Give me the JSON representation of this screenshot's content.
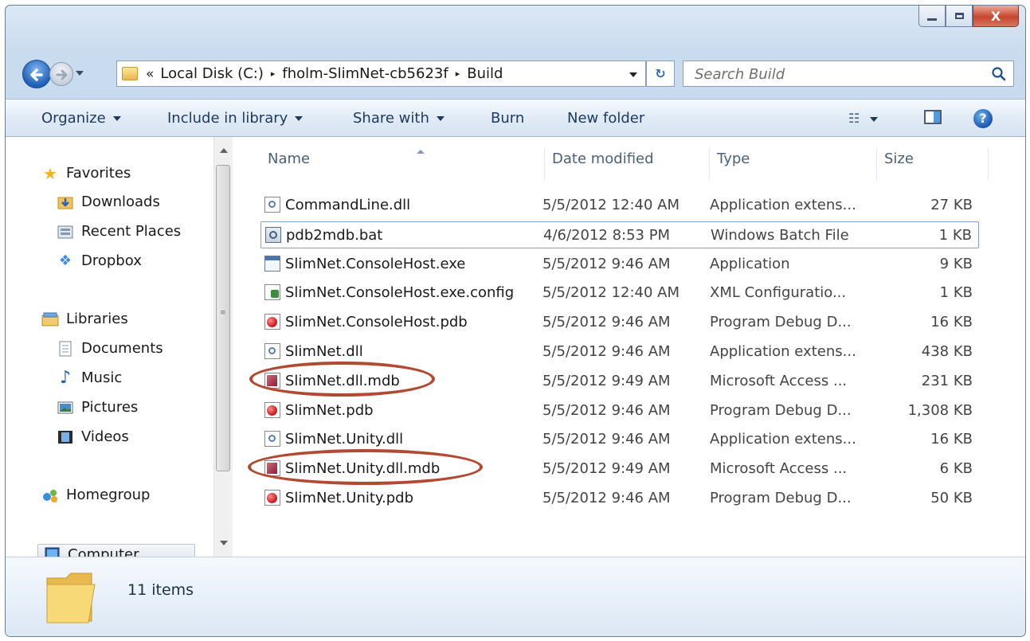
{
  "window": {
    "title_buttons": [
      "minimize",
      "maximize",
      "close"
    ],
    "close_glyph": "X"
  },
  "address": {
    "overflow_chevron": "«",
    "crumbs": [
      "Local Disk (C:)",
      "fholm-SlimNet-cb5623f",
      "Build"
    ],
    "separator": "▸"
  },
  "search": {
    "placeholder": "Search Build"
  },
  "commands": {
    "organize": "Organize",
    "include_in_library": "Include in library",
    "share_with": "Share with",
    "burn": "Burn",
    "new_folder": "New folder"
  },
  "nav": {
    "favorites": "Favorites",
    "downloads": "Downloads",
    "recent_places": "Recent Places",
    "dropbox": "Dropbox",
    "libraries": "Libraries",
    "documents": "Documents",
    "music": "Music",
    "pictures": "Pictures",
    "videos": "Videos",
    "homegroup": "Homegroup",
    "computer": "Computer"
  },
  "columns": {
    "name": "Name",
    "date_modified": "Date modified",
    "type": "Type",
    "size": "Size"
  },
  "files": [
    {
      "icon": "dll-icon",
      "name": "CommandLine.dll",
      "date": "5/5/2012 12:40 AM",
      "type": "Application extens...",
      "size": "27 KB"
    },
    {
      "icon": "batch-file-icon",
      "name": "pdb2mdb.bat",
      "date": "4/6/2012 8:53 PM",
      "type": "Windows Batch File",
      "size": "1 KB",
      "focused": true
    },
    {
      "icon": "exe-icon",
      "name": "SlimNet.ConsoleHost.exe",
      "date": "5/5/2012 9:46 AM",
      "type": "Application",
      "size": "9 KB"
    },
    {
      "icon": "config-file-icon",
      "name": "SlimNet.ConsoleHost.exe.config",
      "date": "5/5/2012 12:40 AM",
      "type": "XML Configuratio...",
      "size": "1 KB"
    },
    {
      "icon": "pdb-icon",
      "name": "SlimNet.ConsoleHost.pdb",
      "date": "5/5/2012 9:46 AM",
      "type": "Program Debug D...",
      "size": "16 KB"
    },
    {
      "icon": "dll-icon",
      "name": "SlimNet.dll",
      "date": "5/5/2012 9:46 AM",
      "type": "Application extens...",
      "size": "438 KB"
    },
    {
      "icon": "access-db-icon",
      "name": "SlimNet.dll.mdb",
      "date": "5/5/2012 9:49 AM",
      "type": "Microsoft Access ...",
      "size": "231 KB",
      "circled": true
    },
    {
      "icon": "pdb-icon",
      "name": "SlimNet.pdb",
      "date": "5/5/2012 9:46 AM",
      "type": "Program Debug D...",
      "size": "1,308 KB"
    },
    {
      "icon": "dll-icon",
      "name": "SlimNet.Unity.dll",
      "date": "5/5/2012 9:46 AM",
      "type": "Application extens...",
      "size": "16 KB"
    },
    {
      "icon": "access-db-icon",
      "name": "SlimNet.Unity.dll.mdb",
      "date": "5/5/2012 9:49 AM",
      "type": "Microsoft Access ...",
      "size": "6 KB",
      "circled": true
    },
    {
      "icon": "pdb-icon",
      "name": "SlimNet.Unity.pdb",
      "date": "5/5/2012 9:46 AM",
      "type": "Program Debug D...",
      "size": "50 KB"
    }
  ],
  "details": {
    "item_count": "11 items"
  },
  "colors": {
    "annotation_oval": "#b04a32",
    "command_text": "#1e395b"
  }
}
